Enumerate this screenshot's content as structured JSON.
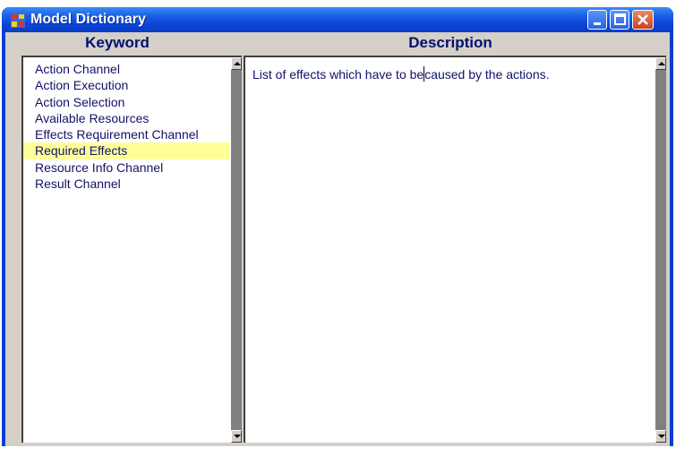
{
  "window": {
    "title": "Model Dictionary"
  },
  "icons": {
    "app": "model-dictionary-app-icon",
    "minimize": "minimize-icon",
    "maximize": "maximize-icon",
    "close": "close-icon"
  },
  "keyword_column": {
    "header": "Keyword",
    "items": [
      "Action Channel",
      "Action Execution",
      "Action Selection",
      "Available Resources",
      "Effects Requirement Channel",
      "Required Effects",
      "Resource Info Channel",
      "Result Channel"
    ],
    "selected": "Required Effects"
  },
  "description_column": {
    "header": "Description",
    "text_before_caret": "List of effects which have to be",
    "text_after_caret": "caused by the actions."
  },
  "colors": {
    "selection": "#ffff99",
    "text": "#11116a",
    "titlebar": "#0b44d6"
  }
}
